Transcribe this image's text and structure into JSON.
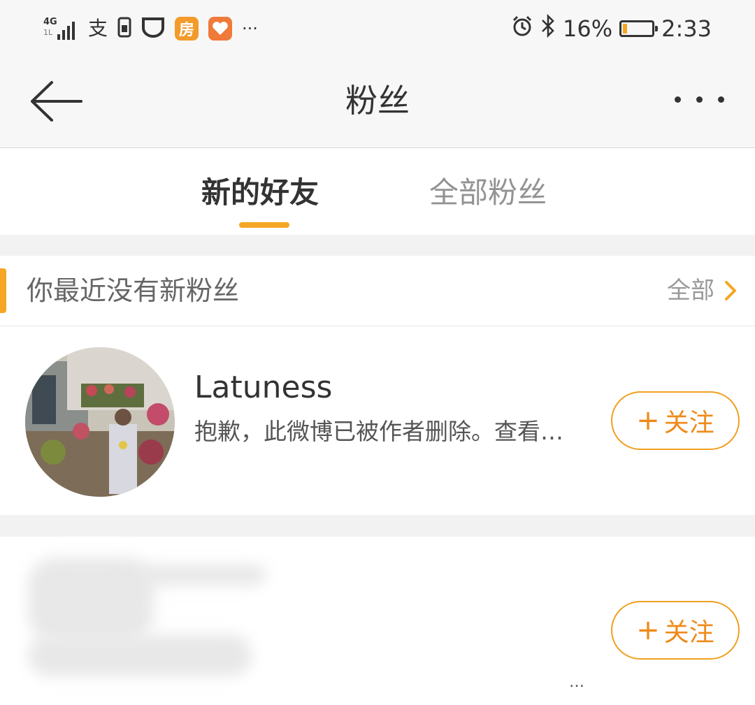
{
  "status_bar": {
    "network": "4G",
    "network_sub": "1L",
    "alipay_glyph": "支",
    "fang_app_label": "房",
    "more_glyph": "···",
    "battery_percent": "16%",
    "battery_level": 0.16,
    "time": "2:33",
    "icons": [
      "signal-icon",
      "alipay-icon",
      "sim-icon",
      "app-icon",
      "fang-app-icon",
      "health-app-icon",
      "alarm-icon",
      "bluetooth-icon",
      "battery-icon"
    ]
  },
  "nav": {
    "title": "粉丝",
    "back_icon": "arrow-left-icon",
    "more_icon": "more-dots-icon"
  },
  "tabs": [
    {
      "label": "新的好友",
      "active": true
    },
    {
      "label": "全部粉丝",
      "active": false
    }
  ],
  "section": {
    "title": "你最近没有新粉丝",
    "view_all_label": "全部",
    "chevron_icon": "chevron-right-icon"
  },
  "users": [
    {
      "name": "Latuness",
      "description": "抱歉，此微博已被作者删除。查看…",
      "follow_label": "关注",
      "follow_plus": "+"
    },
    {
      "name": "",
      "description": "…",
      "follow_label": "关注",
      "follow_plus": "+"
    }
  ],
  "colors": {
    "accent": "#f5a623",
    "follow_text": "#ef8a1a",
    "background": "#f2f2f2"
  }
}
